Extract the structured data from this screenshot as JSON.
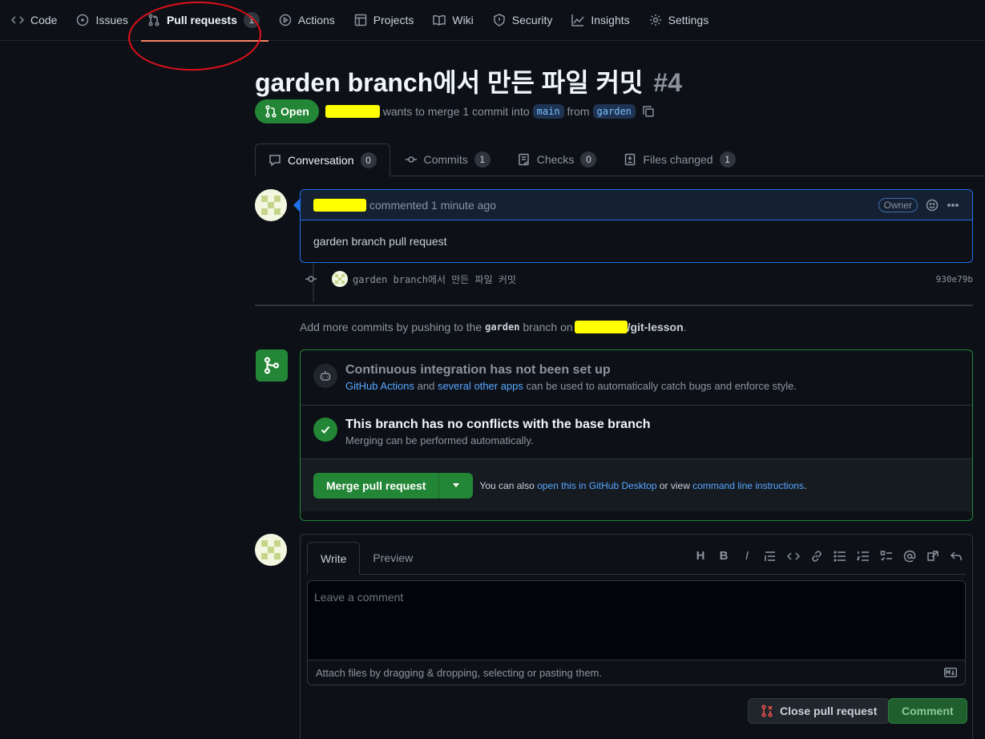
{
  "repo_nav": {
    "items": [
      {
        "label": "Code",
        "icon": "code-icon"
      },
      {
        "label": "Issues",
        "icon": "issue-icon"
      },
      {
        "label": "Pull requests",
        "icon": "pull-request-icon",
        "count": "1",
        "active": true
      },
      {
        "label": "Actions",
        "icon": "play-icon"
      },
      {
        "label": "Projects",
        "icon": "table-icon"
      },
      {
        "label": "Wiki",
        "icon": "book-icon"
      },
      {
        "label": "Security",
        "icon": "shield-icon"
      },
      {
        "label": "Insights",
        "icon": "graph-icon"
      },
      {
        "label": "Settings",
        "icon": "gear-icon"
      }
    ]
  },
  "pr": {
    "title": "garden branch에서 만든 파일 커밋",
    "number": "#4",
    "state": "Open",
    "merge_text": "wants to merge 1 commit into",
    "base_branch": "main",
    "from_text": "from",
    "head_branch": "garden"
  },
  "tabs": [
    {
      "label": "Conversation",
      "count": "0",
      "icon": "comment-icon"
    },
    {
      "label": "Commits",
      "count": "1",
      "icon": "commit-icon"
    },
    {
      "label": "Checks",
      "count": "0",
      "icon": "checklist-icon"
    },
    {
      "label": "Files changed",
      "count": "1",
      "icon": "diff-icon"
    }
  ],
  "comment": {
    "action_text": "commented 1 minute ago",
    "role_badge": "Owner",
    "body": "garden branch pull request"
  },
  "commit": {
    "message": "garden branch에서 만든 파일 커밋",
    "sha": "930e79b"
  },
  "push_hint": {
    "prefix": "Add more commits by pushing to the",
    "branch": "garden",
    "middle": "branch on",
    "repo": "/git-lesson",
    "suffix": "."
  },
  "merge": {
    "ci_title": "Continuous integration has not been set up",
    "ci_link1": "GitHub Actions",
    "ci_and": "and",
    "ci_link2": "several other apps",
    "ci_rest": "can be used to automatically catch bugs and enforce style.",
    "conflict_title": "This branch has no conflicts with the base branch",
    "conflict_desc": "Merging can be performed automatically.",
    "button_label": "Merge pull request",
    "note_prefix": "You can also",
    "note_link1": "open this in GitHub Desktop",
    "note_or": "or view",
    "note_link2": "command line instructions",
    "note_suffix": "."
  },
  "form": {
    "tab_write": "Write",
    "tab_preview": "Preview",
    "placeholder": "Leave a comment",
    "attach_text": "Attach files by dragging & dropping, selecting or pasting them.",
    "close_label": "Close pull request",
    "comment_label": "Comment",
    "toolbar_heading": "H",
    "toolbar_bold": "B",
    "toolbar_italic": "I"
  },
  "colors": {
    "accent_green": "#238636",
    "link_blue": "#58a6ff",
    "background": "#0d1117",
    "annotation_red": "#e0101b"
  }
}
